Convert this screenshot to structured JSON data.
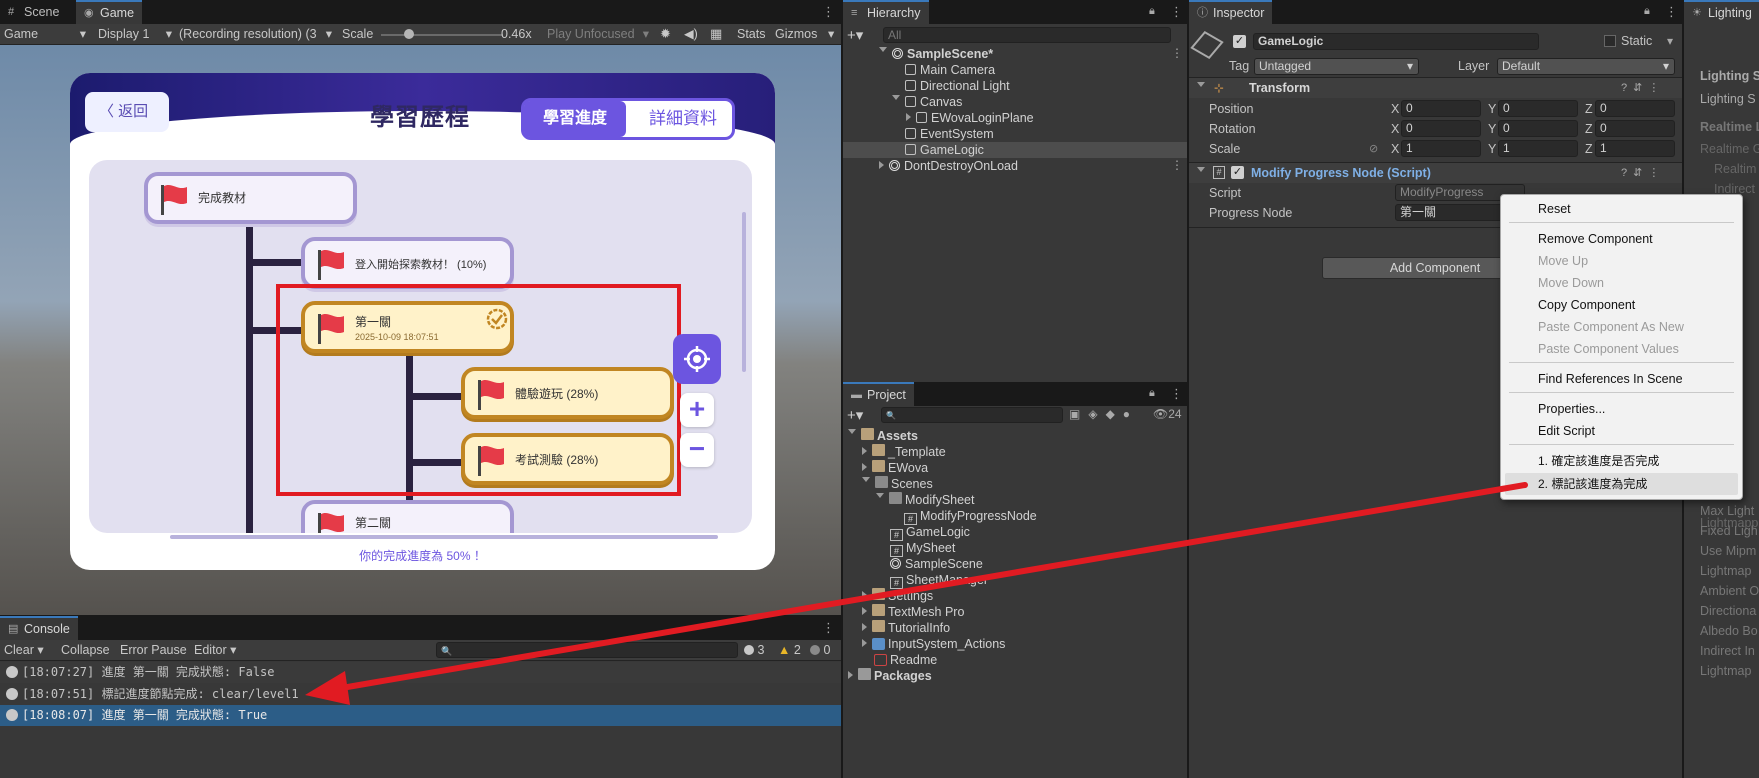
{
  "tabs": {
    "scene": "Scene",
    "game": "Game",
    "hierarchy": "Hierarchy",
    "inspector": "Inspector",
    "lighting": "Lighting",
    "project": "Project",
    "console": "Console"
  },
  "game_toolbar": {
    "mode": "Game",
    "display": "Display 1",
    "resolution": "(Recording resolution) (3",
    "scale_label": "Scale",
    "scale_value": "0.46x",
    "scale_fraction": 0.3,
    "play": "Play Unfocused",
    "stats": "Stats",
    "gizmos": "Gizmos"
  },
  "game_view": {
    "back": "返回",
    "title": "學習歷程",
    "tab_progress": "學習進度",
    "tab_details": "詳細資料",
    "nodes": [
      {
        "label": "完成教材"
      },
      {
        "label": "登入開始探索教材！ (10%)"
      },
      {
        "label": "第一關",
        "sub": "2025-10-09 18:07:51"
      },
      {
        "label": "體驗遊玩 (28%)"
      },
      {
        "label": "考試測驗 (28%)"
      },
      {
        "label": "第二關"
      }
    ],
    "footer": "你的完成進度為 50% ！",
    "plus": "+",
    "minus": "−"
  },
  "hierarchy": {
    "search_placeholder": "All",
    "items": [
      {
        "label": "SampleScene*"
      },
      {
        "label": "Main Camera"
      },
      {
        "label": "Directional Light"
      },
      {
        "label": "Canvas"
      },
      {
        "label": "EWovaLoginPlane"
      },
      {
        "label": "EventSystem"
      },
      {
        "label": "GameLogic"
      },
      {
        "label": "DontDestroyOnLoad"
      }
    ]
  },
  "inspector": {
    "object_name": "GameLogic",
    "static": "Static",
    "tag_label": "Tag",
    "tag": "Untagged",
    "layer_label": "Layer",
    "layer": "Default",
    "transform": "Transform",
    "position_label": "Position",
    "rotation_label": "Rotation",
    "scale_label": "Scale",
    "x": "X",
    "y": "Y",
    "z": "Z",
    "pos": [
      "0",
      "0",
      "0"
    ],
    "rot": [
      "0",
      "0",
      "0"
    ],
    "scl": [
      "1",
      "1",
      "1"
    ],
    "script_component": "Modify Progress Node (Script)",
    "script_label": "Script",
    "script_value": "ModifyProgress",
    "progress_label": "Progress Node",
    "progress_value": "第一關",
    "add_component": "Add Component"
  },
  "context_menu": {
    "items": [
      "Reset",
      "Remove Component",
      "Move Up",
      "Move Down",
      "Copy Component",
      "Paste Component As New",
      "Paste Component Values",
      "Find References In Scene",
      "Properties...",
      "Edit Script",
      "1. 確定該進度是否完成",
      "2. 標記該進度為完成"
    ]
  },
  "lighting_side": [
    "Lighting S",
    "Lighting S",
    "Realtime L",
    "Realtime G",
    "Realtim",
    "Indirect",
    "Lightmapp",
    "Max Light",
    "Fixed Ligh",
    "Use Mipm",
    "Lightmap",
    "Ambient O",
    "Directiona",
    "Albedo Bo",
    "Indirect In",
    "Lightmap"
  ],
  "project": {
    "count": "24",
    "items": [
      "Assets",
      "_Template",
      "EWova",
      "Scenes",
      "ModifySheet",
      "ModifyProgressNode",
      "GameLogic",
      "MySheet",
      "SampleScene",
      "SheetManager",
      "Settings",
      "TextMesh Pro",
      "TutorialInfo",
      "InputSystem_Actions",
      "Readme",
      "Packages"
    ]
  },
  "console": {
    "clear": "Clear",
    "collapse": "Collapse",
    "error_pause": "Error Pause",
    "editor": "Editor",
    "count_log": "3",
    "count_warn": "2",
    "count_err": "0",
    "rows": [
      "[18:07:27] 進度 第一關 完成狀態: False",
      "[18:07:51] 標記進度節點完成: clear/level1",
      "[18:08:07] 進度 第一關 完成狀態: True"
    ]
  }
}
